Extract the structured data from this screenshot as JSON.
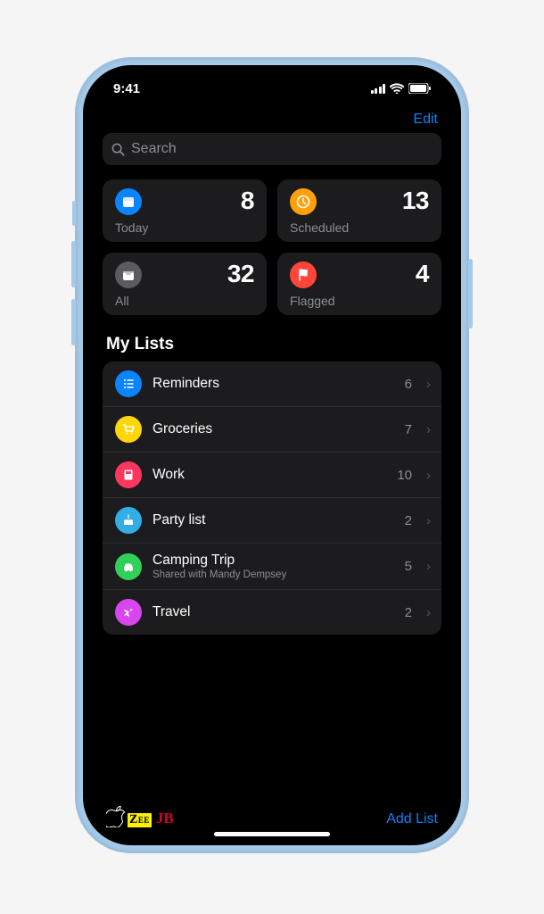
{
  "status": {
    "time": "9:41"
  },
  "nav": {
    "edit": "Edit"
  },
  "search": {
    "placeholder": "Search"
  },
  "cards": {
    "today": {
      "label": "Today",
      "count": "8",
      "color": "#0a84ff"
    },
    "scheduled": {
      "label": "Scheduled",
      "count": "13",
      "color": "#ff9f0a"
    },
    "all": {
      "label": "All",
      "count": "32",
      "color": "#5b5b60"
    },
    "flagged": {
      "label": "Flagged",
      "count": "4",
      "color": "#ff453a"
    }
  },
  "section_title": "My Lists",
  "lists": [
    {
      "title": "Reminders",
      "count": "6",
      "color": "#0a84ff",
      "icon": "list"
    },
    {
      "title": "Groceries",
      "count": "7",
      "color": "#ffd60a",
      "icon": "cart"
    },
    {
      "title": "Work",
      "count": "10",
      "color": "#ff375f",
      "icon": "book"
    },
    {
      "title": "Party list",
      "count": "2",
      "color": "#32ade6",
      "icon": "cake"
    },
    {
      "title": "Camping Trip",
      "count": "5",
      "color": "#30d158",
      "icon": "car",
      "subtitle": "Shared with Mandy Dempsey"
    },
    {
      "title": "Travel",
      "count": "2",
      "color": "#d946ef",
      "icon": "plane"
    }
  ],
  "footer": {
    "add_list": "Add List"
  },
  "watermark": {
    "zee": "ZEE",
    "jb": "JB"
  }
}
